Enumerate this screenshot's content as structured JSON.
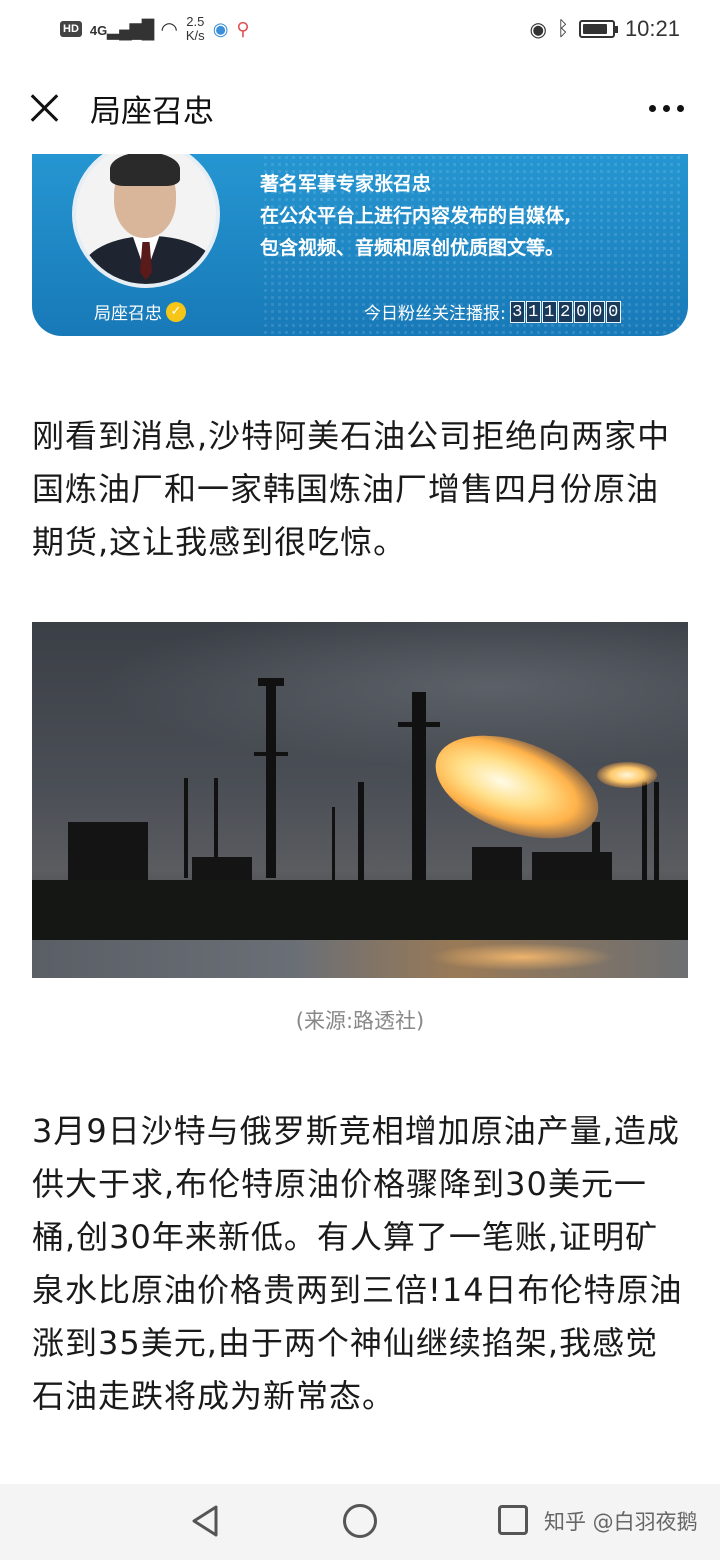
{
  "status_bar": {
    "hd": "HD",
    "signal": "4G",
    "speed_value": "2.5",
    "speed_unit": "K/s",
    "time": "10:21",
    "battery_level": 0.85
  },
  "nav": {
    "title": "局座召忠"
  },
  "banner": {
    "lines": [
      "著名军事专家张召忠",
      "在公众平台上进行内容发布的自媒体,",
      "包含视频、音频和原创优质图文等。"
    ],
    "name": "局座召忠",
    "fans_label": "今日粉丝关注播报:",
    "fans_digits": [
      "3",
      "1",
      "1",
      "2",
      "0",
      "0",
      "0"
    ]
  },
  "article": {
    "para1": "刚看到消息,沙特阿美石油公司拒绝向两家中国炼油厂和一家韩国炼油厂增售四月份原油期货,这让我感到很吃惊。",
    "caption": "(来源:路透社)",
    "para2": "3月9日沙特与俄罗斯竞相增加原油产量,造成供大于求,布伦特原油价格骤降到30美元一桶,创30年来新低。有人算了一笔账,证明矿泉水比原油价格贵两到三倍!14日布伦特原油涨到35美元,由于两个神仙继续掐架,我感觉石油走跌将成为新常态。"
  },
  "bottom_nav": {
    "watermark": "知乎 @白羽夜鹅"
  },
  "colors": {
    "banner_blue": "#1f88c6",
    "flame": "#ffb24a"
  }
}
